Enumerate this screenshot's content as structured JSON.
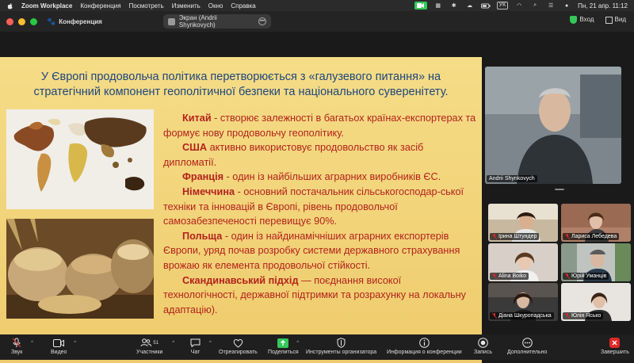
{
  "menubar": {
    "app": "Zoom Workplace",
    "items": [
      "Конференция",
      "Посмотреть",
      "Изменить",
      "Окно",
      "Справка"
    ],
    "keyboard": "УК",
    "datetime": "Пн, 21 апр.  11:12"
  },
  "window": {
    "title": "Конференция",
    "share_label": "Экран (Andrii Shynkovych)",
    "entry_label": "Вход",
    "view_label": "Вид"
  },
  "slide": {
    "title": "У Європі  продовольча політика перетворюється з «галузевого питання» на стратегічний компонент геополітичної безпеки та національного суверенітету.",
    "paragraphs": [
      {
        "bold": "Китай",
        "text": " - створює залежності в багатьох країнах-експортерах та формує нову продовольчу  геополітику."
      },
      {
        "bold": "США",
        "text": " активно використовує продовольство як засіб дипломатії."
      },
      {
        "bold": "Франція",
        "text": " - один із найбільших аграрних виробників ЄС."
      },
      {
        "bold": "Німеччина",
        "text": " - основний постачальник сільськогосподар-ської техніки та інновацій в Європі, рівень продовольчої самозабезпеченості перевищує 90%."
      },
      {
        "bold": "Польща",
        "text": " - один із найдинамічніших аграрних експортерів Європи, уряд почав розробку системи державного страхування врожаю як елемента продовольчої стійкості."
      },
      {
        "bold": "Скандинавський підхід",
        "text": " — поєднання високої технологічності, державної підтримки та розрахунку на локальну адаптацію)."
      }
    ]
  },
  "speaker": {
    "name": "Andrii Shynkovych"
  },
  "participants": [
    {
      "name": "Ірина Штундер",
      "muted": true
    },
    {
      "name": "Лариса Лебедева",
      "muted": true
    },
    {
      "name": "Alina Boiko",
      "muted": true
    },
    {
      "name": "Юрій Уманців",
      "muted": true
    },
    {
      "name": "Діана Шкуропадська",
      "muted": true
    },
    {
      "name": "Юлія Ясько",
      "muted": true
    }
  ],
  "toolbar": {
    "audio": "Звук",
    "video": "Видео",
    "participants": "Участники",
    "participants_count": "51",
    "chat": "Чат",
    "react": "Отреагировать",
    "share": "Поделиться",
    "host_tools": "Инструменты организатора",
    "info": "Информация о конференции",
    "record": "Запись",
    "more": "Дополнительно",
    "end": "Завершить"
  },
  "colors": {
    "slide_bg": "#f3d77e",
    "title_blue": "#1e4680",
    "body_red": "#b3221c",
    "zoom_green": "#34c759",
    "end_red": "#e02828"
  }
}
